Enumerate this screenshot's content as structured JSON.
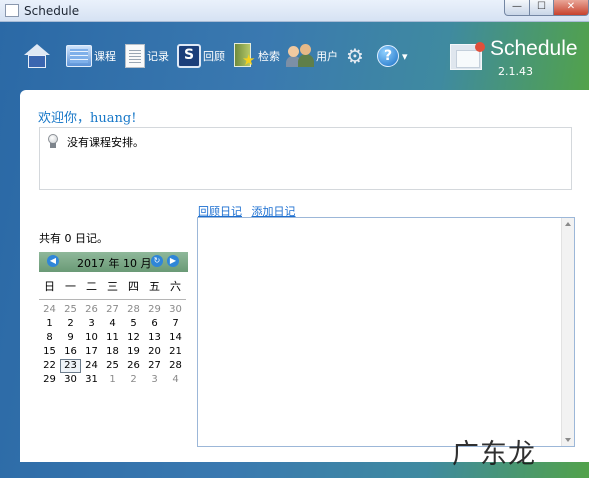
{
  "window": {
    "title": "Schedule"
  },
  "toolbar": {
    "items": [
      {
        "label": "",
        "icon": "home-icon"
      },
      {
        "label": "课程",
        "icon": "course-icon"
      },
      {
        "label": "记录",
        "icon": "record-icon"
      },
      {
        "label": "回顾",
        "icon": "review-icon"
      },
      {
        "label": "检索",
        "icon": "search-icon"
      },
      {
        "label": "用户",
        "icon": "users-icon"
      },
      {
        "label": "",
        "icon": "gear-icon"
      },
      {
        "label": "",
        "icon": "help-icon"
      }
    ]
  },
  "brand": {
    "name": "Schedule",
    "version": "2.1.43"
  },
  "main": {
    "welcome": "欢迎你，huang!",
    "notice": "没有课程安排。",
    "diary_count": "共有 0 日记。",
    "links": {
      "review": "回顾日记",
      "add": "添加日记"
    }
  },
  "calendar": {
    "year_month": "2017 年 10 月",
    "weekdays": [
      "日",
      "一",
      "二",
      "三",
      "四",
      "五",
      "六"
    ],
    "weeks": [
      [
        "24",
        "25",
        "26",
        "27",
        "28",
        "29",
        "30"
      ],
      [
        "1",
        "2",
        "3",
        "4",
        "5",
        "6",
        "7"
      ],
      [
        "8",
        "9",
        "10",
        "11",
        "12",
        "13",
        "14"
      ],
      [
        "15",
        "16",
        "17",
        "18",
        "19",
        "20",
        "21"
      ],
      [
        "22",
        "23",
        "24",
        "25",
        "26",
        "27",
        "28"
      ],
      [
        "29",
        "30",
        "31",
        "1",
        "2",
        "3",
        "4"
      ]
    ],
    "today": "23"
  },
  "watermark": "广东龙网",
  "colors": {
    "header_start": "#2b69a6",
    "header_end": "#52a24a",
    "link": "#1c6fd1",
    "welcome": "#1878c8"
  }
}
